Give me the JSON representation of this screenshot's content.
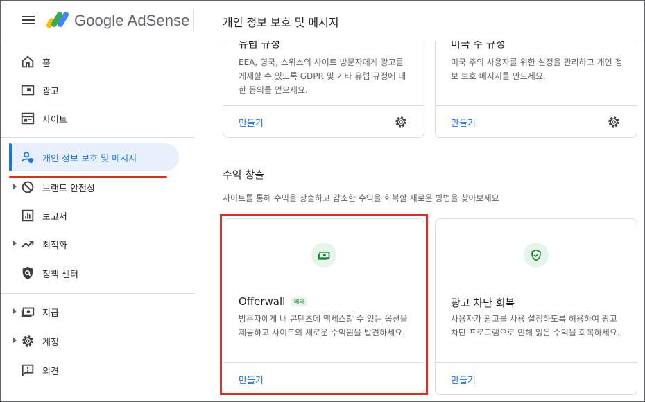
{
  "header": {
    "brand": "Google AdSense",
    "page_title": "개인 정보 보호 및 메시지"
  },
  "sidebar": {
    "items": [
      {
        "label": "홈",
        "icon": "home-icon"
      },
      {
        "label": "광고",
        "icon": "ads-icon"
      },
      {
        "label": "사이트",
        "icon": "sites-icon"
      },
      {
        "label": "개인 정보 보호 및 메시지",
        "icon": "privacy-messaging-icon",
        "active": true
      },
      {
        "label": "브랜드 안전성",
        "icon": "block-icon",
        "expandable": true
      },
      {
        "label": "보고서",
        "icon": "reports-icon"
      },
      {
        "label": "최적화",
        "icon": "trending-icon",
        "expandable": true
      },
      {
        "label": "정책 센터",
        "icon": "policy-shield-icon"
      },
      {
        "label": "지급",
        "icon": "payments-icon",
        "expandable": true
      },
      {
        "label": "계정",
        "icon": "settings-icon",
        "expandable": true
      },
      {
        "label": "의견",
        "icon": "feedback-icon"
      }
    ]
  },
  "cards_top": [
    {
      "title": "유럽 규정",
      "description": "EEA, 영국, 스위스의 사이트 방문자에게 광고를 게재할 수 있도록 GDPR 및 기타 유럽 규정에 대한 동의를 얻으세요.",
      "link": "만들기"
    },
    {
      "title": "미국 주 규정",
      "description": "미국 주의 사용자를 위한 설정을 관리하고 개인 정보 보호 메시지를 만드세요.",
      "link": "만들기"
    }
  ],
  "revenue": {
    "title": "수익 창출",
    "description": "사이트를 통해 수익을 창출하고 감소한 수익을 회복할 새로운 방법을 찾아보세요",
    "cards": [
      {
        "title": "Offerwall",
        "badge": "베타",
        "description": "방문자에게 내 콘텐츠에 액세스할 수 있는 옵션을 제공하고 사이트의 새로운 수익원을 발견하세요.",
        "link": "만들기",
        "icon": "money-icon"
      },
      {
        "title": "광고 차단 회복",
        "description": "사용자가 광고를 사용 설정하도록 허용하여 광고 차단 프로그램으로 인해 잃은 수익을 회복하세요.",
        "link": "만들기",
        "icon": "shield-check-icon"
      }
    ]
  },
  "colors": {
    "accent": "#1a73e8",
    "highlight": "#d93025",
    "icon_bg": "#e6f4ea",
    "icon_fg": "#188038"
  }
}
